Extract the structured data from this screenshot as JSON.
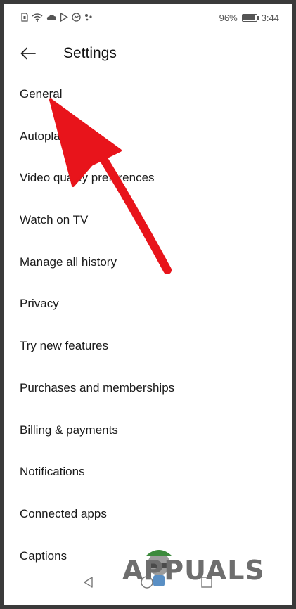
{
  "status_bar": {
    "battery": "96%",
    "time": "3:44"
  },
  "header": {
    "title": "Settings"
  },
  "settings_items": [
    "General",
    "Autoplay",
    "Video quality preferences",
    "Watch on TV",
    "Manage all history",
    "Privacy",
    "Try new features",
    "Purchases and memberships",
    "Billing & payments",
    "Notifications",
    "Connected apps",
    "Captions"
  ],
  "watermark": {
    "text": "APPUALS"
  },
  "colors": {
    "annotation_arrow": "#e8141b",
    "text": "#1a1a1a",
    "background": "#ffffff"
  },
  "icons": {
    "back": "arrow-left-icon",
    "nav_back": "triangle-back-icon",
    "nav_home": "circle-home-icon",
    "nav_recents": "square-recents-icon"
  }
}
